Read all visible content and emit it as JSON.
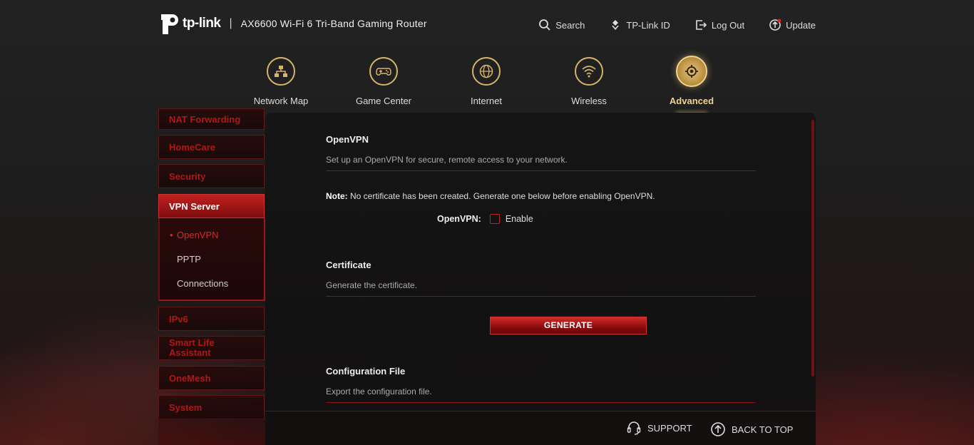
{
  "header": {
    "brand": "tp-link",
    "separator": "|",
    "model": "AX6600 Wi-Fi 6 Tri-Band Gaming Router",
    "actions": [
      {
        "label": "Search",
        "icon": "search-icon"
      },
      {
        "label": "TP-Link ID",
        "icon": "user-id-icon"
      },
      {
        "label": "Log Out",
        "icon": "logout-icon"
      },
      {
        "label": "Update",
        "icon": "update-icon"
      }
    ]
  },
  "nav": {
    "items": [
      {
        "label": "Network Map",
        "icon": "network-map-icon"
      },
      {
        "label": "Game Center",
        "icon": "gamepad-icon"
      },
      {
        "label": "Internet",
        "icon": "globe-icon"
      },
      {
        "label": "Wireless",
        "icon": "wifi-icon"
      },
      {
        "label": "Advanced",
        "icon": "gear-icon",
        "active": true
      }
    ]
  },
  "sidebar": {
    "items": [
      {
        "label": "NAT Forwarding"
      },
      {
        "label": "HomeCare"
      },
      {
        "label": "Security"
      },
      {
        "label": "VPN Server",
        "active": true
      },
      {
        "label": "IPv6"
      },
      {
        "label": "Smart Life Assistant"
      },
      {
        "label": "OneMesh"
      },
      {
        "label": "System"
      }
    ],
    "submenu": [
      {
        "label": "OpenVPN",
        "active": true
      },
      {
        "label": "PPTP"
      },
      {
        "label": "Connections"
      }
    ]
  },
  "main": {
    "openvpn": {
      "title": "OpenVPN",
      "description": "Set up an OpenVPN for secure, remote access to your network.",
      "note_label": "Note:",
      "note_text": " No certificate has been created. Generate one below before enabling OpenVPN.",
      "toggle_label": "OpenVPN:",
      "toggle_text": "Enable",
      "enabled": false
    },
    "certificate": {
      "title": "Certificate",
      "description": "Generate the certificate.",
      "button_label": "GENERATE"
    },
    "config_file": {
      "title": "Configuration File",
      "description": "Export the configuration file."
    }
  },
  "footer": {
    "support_label": "SUPPORT",
    "back_to_top_label": "BACK TO TOP"
  },
  "colors": {
    "accent_red": "#c22020",
    "gold": "#e6c15f",
    "background": "#1d1d1d"
  }
}
